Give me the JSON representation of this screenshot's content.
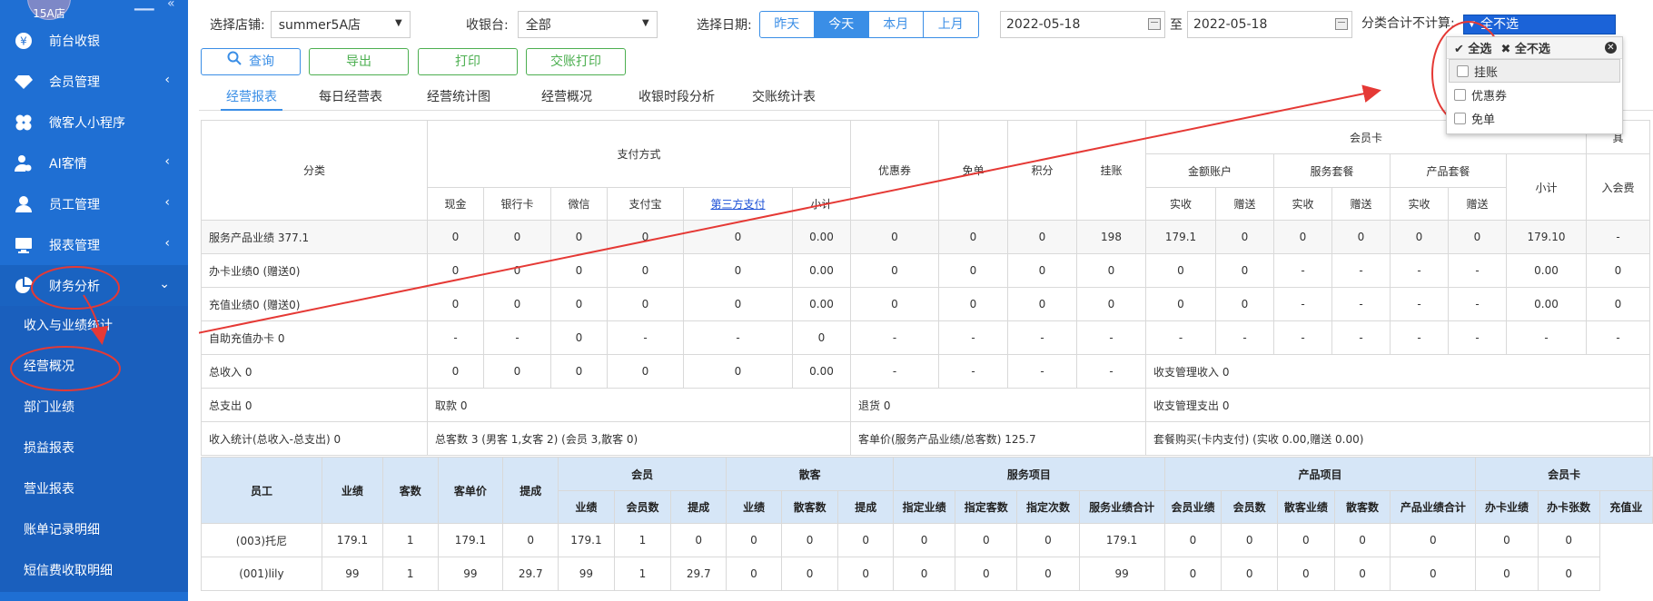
{
  "sidebar": {
    "logo": "15A店",
    "head_icons": [
      "menu-icon",
      "collapse-icon"
    ],
    "items": [
      {
        "label": "前台收银",
        "icon": "yen-icon",
        "arrow": ""
      },
      {
        "label": "会员管理",
        "icon": "diamond-icon",
        "arrow": "‹"
      },
      {
        "label": "微客人小程序",
        "icon": "clover-icon",
        "arrow": ""
      },
      {
        "label": "AI客情",
        "icon": "user-gear-icon",
        "arrow": "‹"
      },
      {
        "label": "员工管理",
        "icon": "user-icon",
        "arrow": "‹"
      },
      {
        "label": "报表管理",
        "icon": "monitor-icon",
        "arrow": "‹"
      },
      {
        "label": "财务分析",
        "icon": "pie-icon",
        "arrow": "⌄"
      }
    ],
    "subitems": [
      "收入与业绩统计",
      "经营概况",
      "部门业绩",
      "损益报表",
      "营业报表",
      "账单记录明细",
      "短信费收取明细"
    ]
  },
  "filters": {
    "store_label": "选择店铺:",
    "store_value": "summer5A店",
    "register_label": "收银台:",
    "register_value": "全部",
    "date_label": "选择日期:",
    "date_buttons": [
      "昨天",
      "今天",
      "本月",
      "上月"
    ],
    "start_date": "2022-05-18",
    "to": "至",
    "end_date": "2022-05-18",
    "exclude_label": "分类合计不计算:",
    "exclude_value": "全不选"
  },
  "buttons": {
    "query": "查询",
    "export": "导出",
    "print": "打印",
    "shift_print": "交账打印"
  },
  "tabs": [
    "经营报表",
    "每日经营表",
    "经营统计图",
    "经营概况",
    "收银时段分析",
    "交账统计表"
  ],
  "dropdown": {
    "select_all": "全选",
    "select_none": "全不选",
    "options": [
      "挂账",
      "优惠券",
      "免单"
    ]
  },
  "report": {
    "h_category": "分类",
    "h_payment": "支付方式",
    "h_pay_cols": [
      "现金",
      "银行卡",
      "微信",
      "支付宝",
      "第三方支付",
      "小计"
    ],
    "h_singles": [
      "优惠券",
      "免单",
      "积分",
      "挂账"
    ],
    "h_member_card": "会员卡",
    "h_mc_groups": [
      "金额账户",
      "服务套餐",
      "产品套餐"
    ],
    "h_mc_sub": [
      "实收",
      "赠送",
      "实收",
      "赠送",
      "实收",
      "赠送"
    ],
    "h_subtotal": "小计",
    "h_enter": "入会费",
    "h_extra": "其",
    "rows": [
      [
        "服务产品业绩 377.1",
        "0",
        "0",
        "0",
        "0",
        "0",
        "0.00",
        "0",
        "0",
        "0",
        "198",
        "179.1",
        "0",
        "0",
        "0",
        "0",
        "0",
        "179.10",
        "-"
      ],
      [
        "办卡业绩0 (赠送0)",
        "0",
        "0",
        "0",
        "0",
        "0",
        "0.00",
        "0",
        "0",
        "0",
        "0",
        "0",
        "0",
        "-",
        "-",
        "-",
        "-",
        "0.00",
        "0"
      ],
      [
        "充值业绩0 (赠送0)",
        "0",
        "0",
        "0",
        "0",
        "0",
        "0.00",
        "0",
        "0",
        "0",
        "0",
        "0",
        "0",
        "-",
        "-",
        "-",
        "-",
        "0.00",
        "0"
      ],
      [
        "自助充值办卡 0",
        "-",
        "-",
        "0",
        "-",
        "-",
        "0",
        "-",
        "-",
        "-",
        "-",
        "-",
        "-",
        "-",
        "-",
        "-",
        "-",
        "-",
        "-"
      ],
      [
        "总收入 0",
        "0",
        "0",
        "0",
        "0",
        "0",
        "0.00",
        "-",
        "-",
        "-",
        "-"
      ]
    ],
    "income_mgmt": "收支管理收入 0",
    "total_expense": "总支出 0",
    "withdraw": "取款 0",
    "return_goods": "退货 0",
    "expense_mgmt": "收支管理支出 0",
    "income_stat": "收入统计(总收入-总支出) 0",
    "guests": "总客数 3 (男客 1,女客 2) (会员 3,散客 0)",
    "avg": "客单价(服务产品业绩/总客数) 125.7",
    "package": "套餐购买(卡内支付) (实收 0.00,赠送 0.00)"
  },
  "staff": {
    "h_main": [
      "员工",
      "业绩",
      "客数",
      "客单价",
      "提成"
    ],
    "h_groups": [
      "会员",
      "散客",
      "服务项目",
      "产品项目",
      "会员卡"
    ],
    "h_sub": [
      "业绩",
      "会员数",
      "提成",
      "业绩",
      "散客数",
      "提成",
      "指定业绩",
      "指定客数",
      "指定次数",
      "服务业绩合计",
      "会员业绩",
      "会员数",
      "散客业绩",
      "散客数",
      "产品业绩合计",
      "办卡业绩",
      "办卡张数",
      "充值业"
    ],
    "rows": [
      [
        "(003)托尼",
        "179.1",
        "1",
        "179.1",
        "0",
        "179.1",
        "1",
        "0",
        "0",
        "0",
        "0",
        "0",
        "0",
        "0",
        "179.1",
        "0",
        "0",
        "0",
        "0",
        "0",
        "0",
        "0"
      ],
      [
        "(001)lily",
        "99",
        "1",
        "99",
        "29.7",
        "99",
        "1",
        "29.7",
        "0",
        "0",
        "0",
        "0",
        "0",
        "0",
        "99",
        "0",
        "0",
        "0",
        "0",
        "0",
        "0",
        "0"
      ]
    ]
  },
  "colors": {
    "sidebar": "#1f6fd3",
    "accent": "#3a8ee6",
    "green": "#4caf50",
    "annotation": "#e53935",
    "staff_header": "#d6e6f7"
  }
}
